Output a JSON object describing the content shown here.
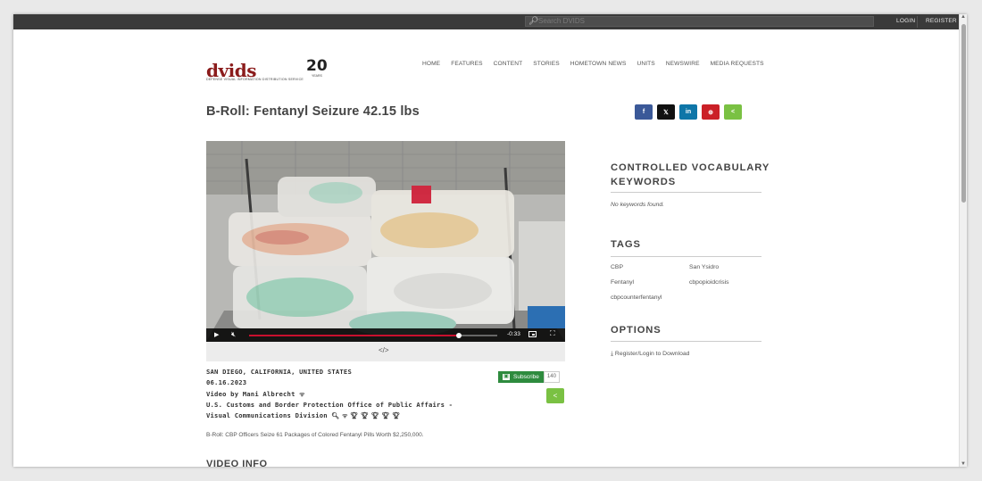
{
  "topbar": {
    "search_placeholder": "Search DVIDS",
    "login": "LOGIN",
    "register": "REGISTER"
  },
  "logo": {
    "word": "dvids",
    "tagline": "DEFENSE VISUAL INFORMATION DISTRIBUTION SERVICE",
    "anniversary": "20",
    "anniversary_sub": "YEARS"
  },
  "nav": [
    "HOME",
    "FEATURES",
    "CONTENT",
    "STORIES",
    "HOMETOWN NEWS",
    "UNITS",
    "NEWSWIRE",
    "MEDIA REQUESTS"
  ],
  "page": {
    "title": "B-Roll: Fentanyl Seizure 42.15 lbs"
  },
  "share_buttons": [
    {
      "name": "facebook",
      "label": "f",
      "color": "#3b5998"
    },
    {
      "name": "x",
      "label": "𝕏",
      "color": "#111111"
    },
    {
      "name": "linkedin",
      "label": "in",
      "color": "#0e76a8"
    },
    {
      "name": "pinterest",
      "label": "⊕",
      "color": "#cb2027"
    },
    {
      "name": "share",
      "label": "<",
      "color": "#7ac143"
    }
  ],
  "player": {
    "time": "-0:33",
    "progress": 0.845,
    "embed": "</>"
  },
  "meta": {
    "location": "SAN DIEGO, CALIFORNIA, UNITED STATES",
    "date": "06.16.2023",
    "author": "Video by Mani Albrecht",
    "unit_line1": "U.S. Customs and Border Protection Office of Public Affairs -",
    "unit_line2": "Visual Communications Division",
    "subscribe": "Subscribe",
    "subscribers": "140"
  },
  "description": "B-Roll: CBP Officers Seize 61 Packages of Colored Fentanyl Pills Worth $2,250,000.",
  "video_info_heading": "VIDEO INFO",
  "sidebar": {
    "keywords_heading_1": "CONTROLLED VOCABULARY",
    "keywords_heading_2": "KEYWORDS",
    "no_keywords": "No keywords found.",
    "tags_heading": "TAGS",
    "tags": [
      "CBP",
      "San Ysidro",
      "Fentanyl",
      "cbpopioidcrisis",
      "cbpcounterfentanyl"
    ],
    "options_heading": "OPTIONS",
    "download": "Register/Login to Download"
  }
}
